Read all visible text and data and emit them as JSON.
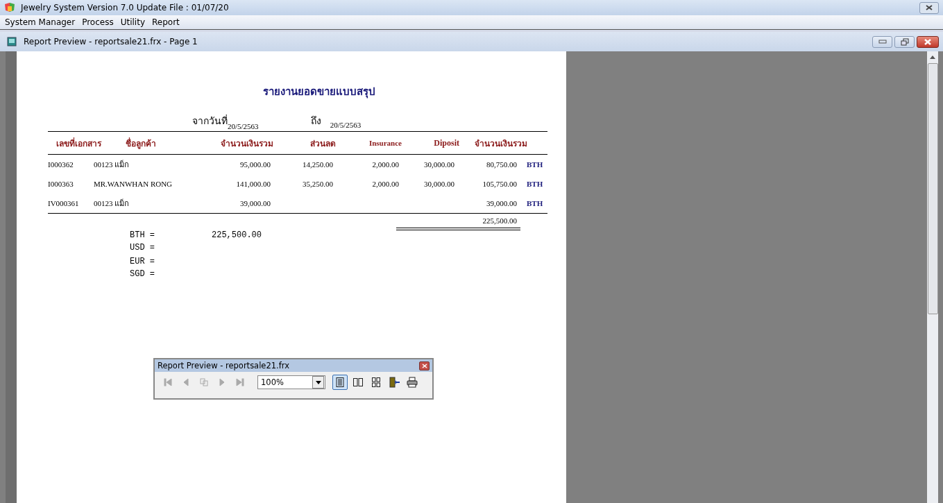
{
  "window": {
    "title": "Jewelry System Version 7.0 Update File : 01/07/20"
  },
  "menu": [
    "System Manager",
    "Process",
    "Utility",
    "Report"
  ],
  "child_window": {
    "title": "Report Preview - reportsale21.frx - Page 1"
  },
  "report": {
    "title": "รายงานยอดขายแบบสรุป",
    "from_label": "จากวันที่",
    "from_date": "20/5/2563",
    "to_label": "ถึง",
    "to_date": "20/5/2563",
    "columns": [
      "เลขที่เอกสาร",
      "ชื่อลูกค้า",
      "จำนวนเงินรวม",
      "ส่วนลด",
      "Insurance",
      "Diposit",
      "จำนวนเงินรวม"
    ],
    "rows": [
      {
        "doc_no": "I000362",
        "customer": "00123 แม็ก",
        "amount": "95,000.00",
        "discount": "14,250.00",
        "insurance": "2,000.00",
        "deposit": "30,000.00",
        "total": "80,750.00",
        "currency": "BTH"
      },
      {
        "doc_no": "I000363",
        "customer": "MR.WANWHAN  RONG",
        "amount": "141,000.00",
        "discount": "35,250.00",
        "insurance": "2,000.00",
        "deposit": "30,000.00",
        "total": "105,750.00",
        "currency": "BTH"
      },
      {
        "doc_no": "IV000361",
        "customer": "00123 แม็ก",
        "amount": "39,000.00",
        "discount": "",
        "insurance": "",
        "deposit": "",
        "total": "39,000.00",
        "currency": "BTH"
      }
    ],
    "grand_total": "225,500.00",
    "currency_totals": [
      {
        "label": "BTH =",
        "amount": "225,500.00"
      },
      {
        "label": "USD ="
      },
      {
        "label": "EUR ="
      },
      {
        "label": "SGD ="
      }
    ]
  },
  "preview_toolbar": {
    "title": "Report Preview - reportsale21.frx",
    "nav_buttons": [
      {
        "kind": "first",
        "disabled": true
      },
      {
        "kind": "prev",
        "disabled": true
      },
      {
        "kind": "goto",
        "disabled": true
      },
      {
        "kind": "next",
        "disabled": true
      },
      {
        "kind": "last",
        "disabled": true
      }
    ],
    "zoom": "100%",
    "view_buttons": [
      {
        "kind": "one",
        "selected": true
      },
      {
        "kind": "two",
        "selected": false
      },
      {
        "kind": "four",
        "selected": false
      }
    ]
  }
}
